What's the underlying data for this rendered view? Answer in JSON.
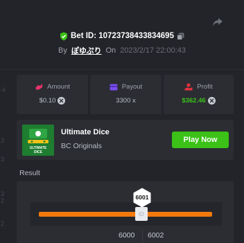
{
  "bet": {
    "bet_id_label": "Bet ID: 107237384338346​95",
    "by_label": "By",
    "username": "ぽゆぷり",
    "on_label": "On",
    "timestamp": "2023/2/17 22:00:43"
  },
  "stats": {
    "amount_title": "Amount",
    "amount_value": "$0.10",
    "payout_title": "Payout",
    "payout_value": "3300 x",
    "profit_title": "Profit",
    "profit_value": "$362.46"
  },
  "game": {
    "name": "Ultimate Dice",
    "provider": "BC Originals",
    "play_label": "Play Now",
    "thumb_text": "ULTIMATE DICE"
  },
  "result": {
    "label": "Result",
    "marker_value": "6001",
    "handle_label": "ID",
    "range_low": "6000",
    "range_high": "6002"
  },
  "left_strip": [
    "-li",
    "3",
    "3",
    "3",
    "2",
    "2"
  ],
  "colors": {
    "background": "#232429",
    "card": "#2b2d33",
    "accent_green": "#3bc117",
    "profit_green": "#3bc117",
    "slider_orange": "#f27a0c",
    "amount_pink": "#e8336b",
    "payout_purple": "#7a4df0",
    "profit_red": "#e5323e"
  },
  "icons": [
    "share-icon",
    "verified-shield-icon",
    "copy-icon",
    "amount-icon",
    "payout-icon",
    "profit-icon",
    "coin-icon"
  ]
}
